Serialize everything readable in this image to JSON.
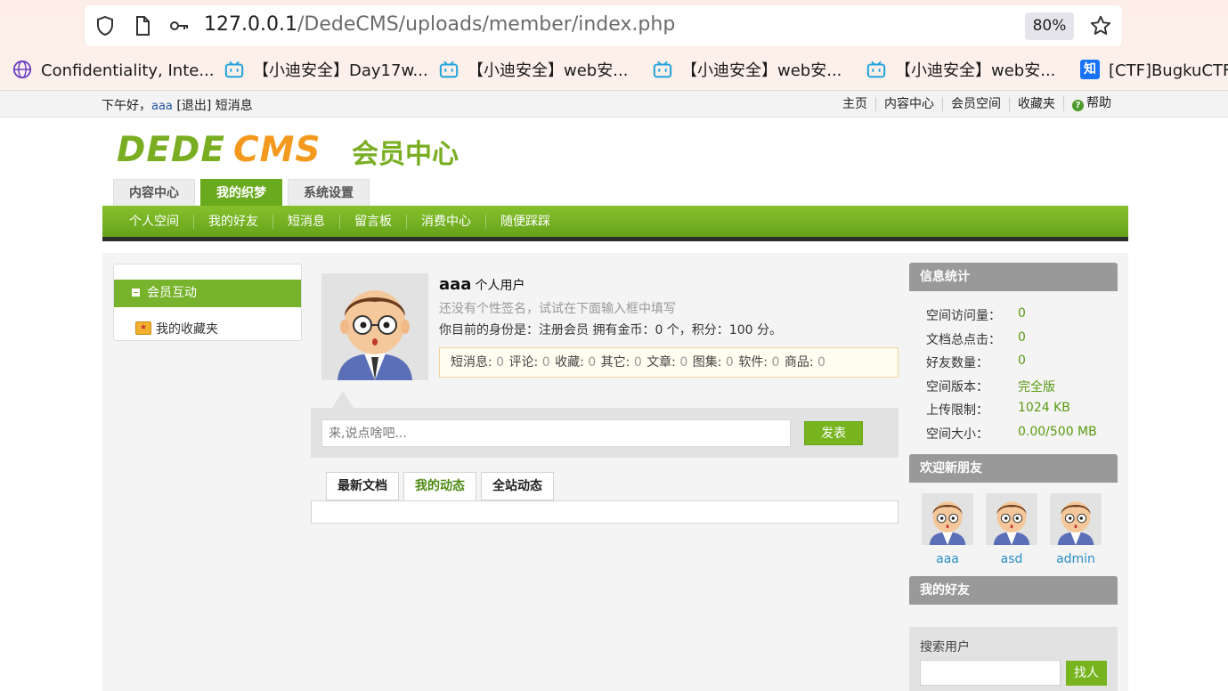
{
  "browser": {
    "url_host": "127.0.0.1",
    "url_path": "/DedeCMS/uploads/member/index.php",
    "zoom": "80%",
    "bookmarks": [
      {
        "label": "Confidentiality, Inte..."
      },
      {
        "label": "【小迪安全】Day17w..."
      },
      {
        "label": "【小迪安全】web安..."
      },
      {
        "label": "【小迪安全】web安..."
      },
      {
        "label": "【小迪安全】web安..."
      },
      {
        "label": "[CTF]BugkuCTF"
      }
    ],
    "zhihu_glyph": "知"
  },
  "topbar": {
    "greeting": "下午好，",
    "username": "aaa",
    "logout": "[退出]",
    "messages": "短消息",
    "links": [
      "主页",
      "内容中心",
      "会员空间",
      "收藏夹"
    ],
    "help": "帮助",
    "help_glyph": "?"
  },
  "logo": {
    "part1": "DEDE",
    "part2": "CMS",
    "part3": "会员中心"
  },
  "main_tabs": [
    "内容中心",
    "我的织梦",
    "系统设置"
  ],
  "nav_items": [
    "个人空间",
    "我的好友",
    "短消息",
    "留言板",
    "消费中心",
    "随便踩踩"
  ],
  "left_menu": {
    "header": "会员互动",
    "items": [
      "我的收藏夹"
    ]
  },
  "profile": {
    "name": "aaa",
    "type": "个人用户",
    "signature_hint": "还没有个性签名，试试在下面输入框中填写",
    "identity": "你目前的身份是：注册会员 拥有金币：0 个，积分：100 分。",
    "stats": [
      {
        "label": "短消息:",
        "value": "0"
      },
      {
        "label": "评论:",
        "value": "0"
      },
      {
        "label": "收藏:",
        "value": "0"
      },
      {
        "label": "其它:",
        "value": "0"
      },
      {
        "label": "文章:",
        "value": "0"
      },
      {
        "label": "图集:",
        "value": "0"
      },
      {
        "label": "软件:",
        "value": "0"
      },
      {
        "label": "商品:",
        "value": "0"
      }
    ]
  },
  "post": {
    "placeholder": "来,说点啥吧...",
    "button": "发表"
  },
  "feed_tabs": [
    "最新文档",
    "我的动态",
    "全站动态"
  ],
  "sidebar": {
    "info_title": "信息统计",
    "info": [
      {
        "k": "空间访问量：",
        "v": "0"
      },
      {
        "k": "文档总点击：",
        "v": "0"
      },
      {
        "k": "好友数量：",
        "v": "0"
      },
      {
        "k": "空间版本：",
        "v": "完全版"
      },
      {
        "k": "上传限制：",
        "v": "1024 KB"
      },
      {
        "k": "空间大小：",
        "v": "0.00/500 MB"
      }
    ],
    "new_friends_title": "欢迎新朋友",
    "new_friends": [
      "aaa",
      "asd",
      "admin"
    ],
    "my_friends_title": "我的好友",
    "search_label": "搜索用户",
    "search_button": "找人"
  }
}
